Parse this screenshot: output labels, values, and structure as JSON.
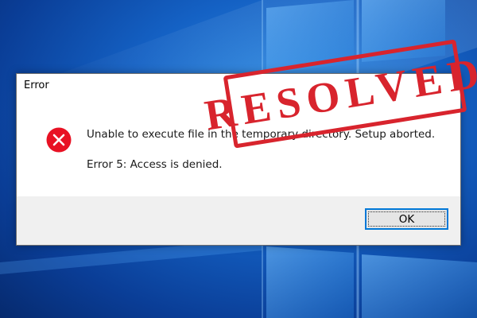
{
  "dialog": {
    "title": "Error",
    "message_line1": "Unable to execute file in the temporary directory. Setup aborted.",
    "message_line2": "Error 5: Access is denied.",
    "ok_label": "OK",
    "icon": "error-icon"
  },
  "stamp": {
    "text": "RESOLVED",
    "color": "#d8242d"
  },
  "colors": {
    "accent": "#0078d7",
    "error_red": "#e81123",
    "desktop_blue": "#1461c4"
  }
}
